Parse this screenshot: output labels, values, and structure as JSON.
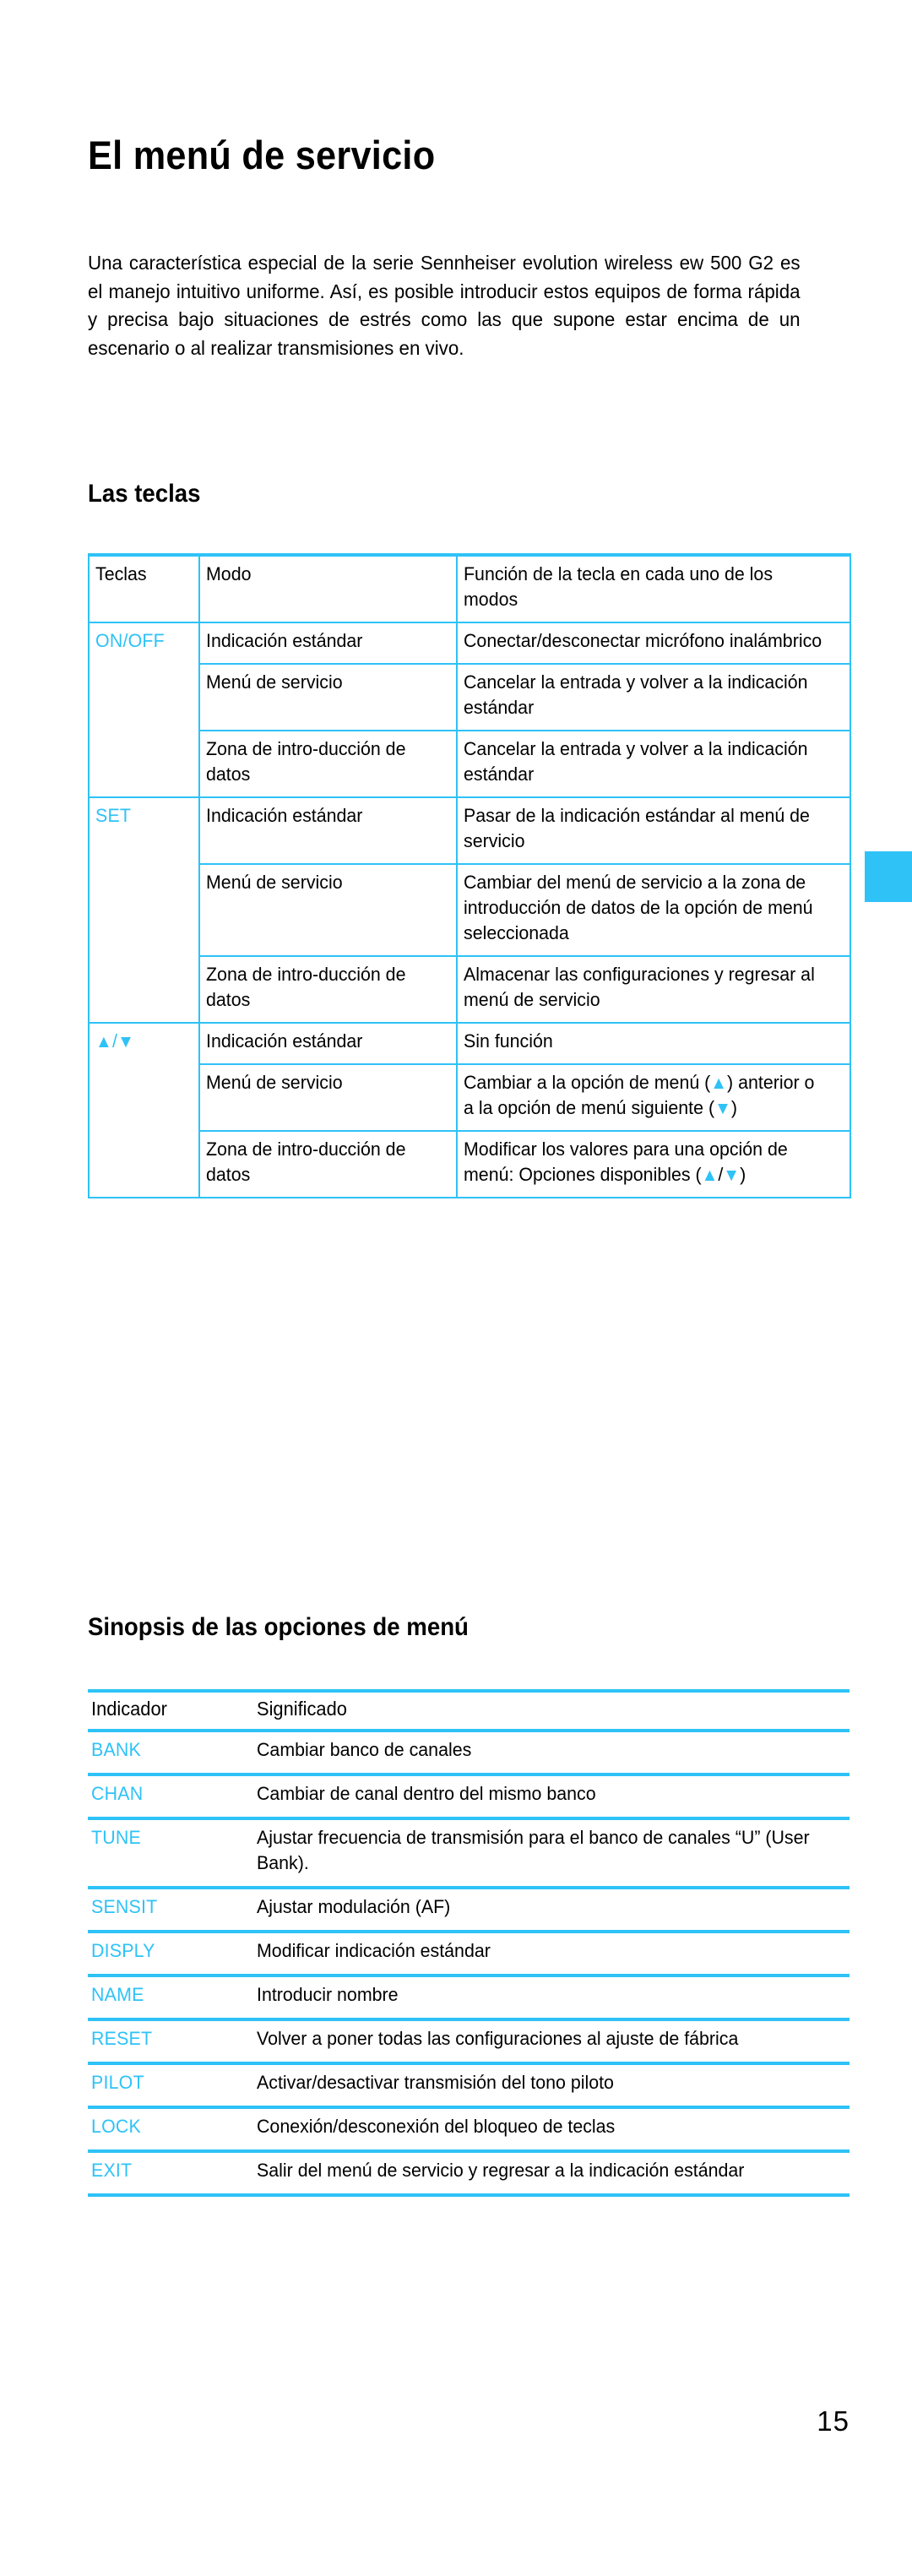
{
  "document": {
    "title": "El menú de servicio",
    "intro": "Una característica especial de la serie Sennheiser evolution wireless ew 500 G2 es el manejo intuitivo uniforme. Así, es posible introducir estos equipos de forma rápida y precisa bajo situaciones de estrés como las que supone estar encima de un escenario o al realizar transmisiones en vivo.",
    "page_number": "15",
    "accent_color": "#2ec2f7"
  },
  "keys_section": {
    "heading": "Las teclas",
    "headers": {
      "keys": "Teclas",
      "mode": "Modo",
      "function": "Función de la tecla en cada uno de los modos"
    },
    "rows": [
      {
        "key": "ON/OFF",
        "key_type": "text",
        "modes": [
          {
            "mode": "Indicación estándar",
            "function": "Conectar/desconectar micrófono inalámbrico"
          },
          {
            "mode": "Menú de servicio",
            "function": "Cancelar la entrada y volver a la indicación estándar"
          },
          {
            "mode": "Zona de intro-ducción de datos",
            "function": "Cancelar la entrada y volver a la indicación estándar"
          }
        ]
      },
      {
        "key": "SET",
        "key_type": "text",
        "modes": [
          {
            "mode": "Indicación estándar",
            "function": "Pasar de la indicación estándar al menú de servicio"
          },
          {
            "mode": "Menú de servicio",
            "function": "Cambiar del menú de servicio a la zona de introducción de datos de la opción de menú seleccionada"
          },
          {
            "mode": "Zona de intro-ducción de datos",
            "function": "Almacenar las configuraciones y regresar al menú de servicio"
          }
        ]
      },
      {
        "key": "▲/▼",
        "key_type": "arrows",
        "modes": [
          {
            "mode": "Indicación estándar",
            "function": "Sin función"
          },
          {
            "mode": "Menú de servicio",
            "function": "Cambiar a la opción de menú (▲) anterior o a la opción de menú siguiente (▼)"
          },
          {
            "mode": "Zona de intro-ducción de datos",
            "function": "Modificar los valores para una opción de menú: Opciones disponibles (▲/▼)"
          }
        ]
      }
    ]
  },
  "menu_section": {
    "heading": "Sinopsis de las opciones de menú",
    "headers": {
      "indicator": "Indicador",
      "meaning": "Significado"
    },
    "rows": [
      {
        "indicator": "BANK",
        "meaning": "Cambiar banco de canales"
      },
      {
        "indicator": "CHAN",
        "meaning": "Cambiar de canal dentro del mismo banco"
      },
      {
        "indicator": "TUNE",
        "meaning": "Ajustar frecuencia de transmisión para el banco de canales “U” (User Bank)."
      },
      {
        "indicator": "SENSIT",
        "meaning": "Ajustar modulación (AF)"
      },
      {
        "indicator": "DISPLY",
        "meaning": "Modificar indicación estándar"
      },
      {
        "indicator": "NAME",
        "meaning": "Introducir nombre"
      },
      {
        "indicator": "RESET",
        "meaning": "Volver a poner todas las configuraciones al ajuste de fábrica"
      },
      {
        "indicator": "PILOT",
        "meaning": "Activar/desactivar transmisión del tono piloto"
      },
      {
        "indicator": "LOCK",
        "meaning": "Conexión/desconexión del bloqueo de teclas"
      },
      {
        "indicator": "EXIT",
        "meaning": "Salir del menú de servicio y regresar a la indicación estándar"
      }
    ]
  }
}
